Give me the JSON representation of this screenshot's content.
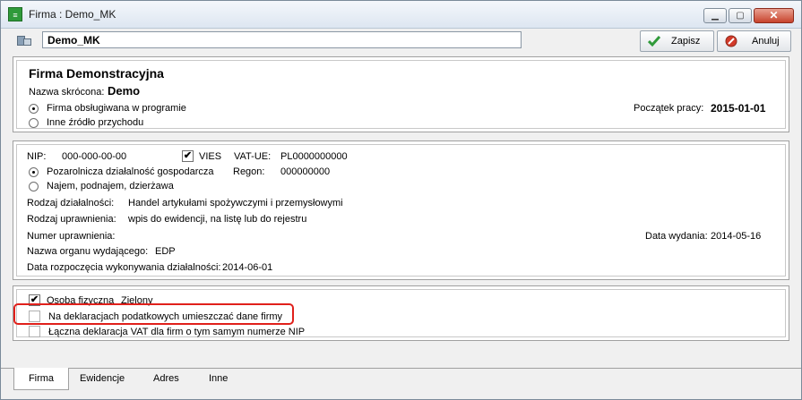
{
  "window": {
    "title": "Firma : Demo_MK"
  },
  "toolbar": {
    "name_value": "Demo_MK",
    "save_label": "Zapisz",
    "cancel_label": "Anuluj"
  },
  "firm": {
    "full_name": "Firma Demonstracyjna",
    "short_name_label": "Nazwa skrócona:",
    "short_name_value": "Demo",
    "radio_serviced_label": "Firma obsługiwana w programie",
    "radio_other_label": "Inne źródło przychodu",
    "start_label": "Początek pracy:",
    "start_value": "2015-01-01"
  },
  "tax": {
    "nip_label": "NIP:",
    "nip_value": "000-000-00-00",
    "vies_label": "VIES",
    "vatue_label": "VAT-UE:",
    "vatue_value": "PL0000000000",
    "radio_business_label": "Pozarolnicza działalność gospodarcza",
    "radio_lease_label": "Najem, podnajem, dzierżawa",
    "regon_label": "Regon:",
    "regon_value": "000000000",
    "activity_label": "Rodzaj działalności:",
    "activity_value": "Handel artykułami spożywczymi i przemysłowymi",
    "permit_type_label": "Rodzaj uprawnienia:",
    "permit_type_value": "wpis do ewidencji, na listę lub do rejestru",
    "permit_number_label": "Numer uprawnienia:",
    "issue_date_label": "Data wydania:",
    "issue_date_value": "2014-05-16",
    "authority_label": "Nazwa organu wydającego:",
    "authority_value": "EDP",
    "activity_start_label": "Data rozpoczęcia wykonywania działalności:",
    "activity_start_value": "2014-06-01"
  },
  "options": {
    "person_label": "Osoba fizyczna",
    "person_name": "Zielony",
    "declarations_label": "Na deklaracjach podatkowych umieszczać dane firmy",
    "joint_vat_label": "Łączna deklaracja VAT dla firm o tym samym numerze NIP"
  },
  "tabs": [
    {
      "label": "Firma"
    },
    {
      "label": "Ewidencje"
    },
    {
      "label": "Adres"
    },
    {
      "label": "Inne"
    }
  ],
  "colors": {
    "highlight": "#e0201b",
    "save_icon": "#2f9a3a",
    "cancel_icon": "#d23a2a"
  }
}
